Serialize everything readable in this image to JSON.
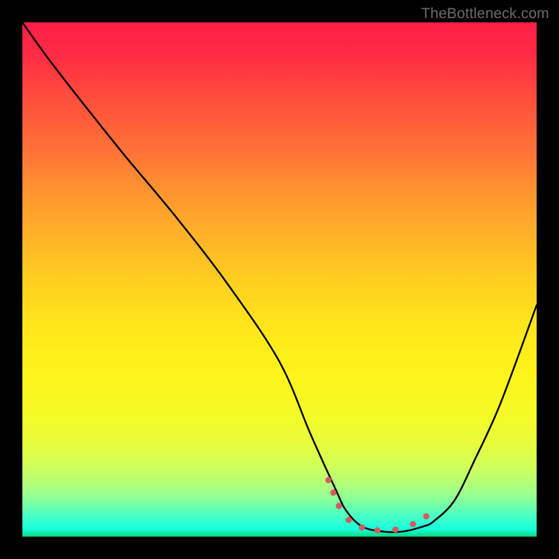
{
  "watermark": "TheBottleneck.com",
  "chart_data": {
    "type": "line",
    "title": "",
    "xlabel": "",
    "ylabel": "",
    "xlim": [
      0,
      100
    ],
    "ylim": [
      0,
      100
    ],
    "series": [
      {
        "name": "bottleneck-curve",
        "x": [
          0,
          5,
          12,
          20,
          30,
          40,
          50,
          56,
          61,
          63,
          66,
          70,
          74,
          78,
          80,
          84,
          88,
          93,
          100
        ],
        "values": [
          100,
          93,
          84,
          74,
          62,
          49,
          34,
          20,
          9,
          5,
          2,
          1,
          1,
          2,
          3,
          7,
          15,
          26,
          45
        ]
      }
    ],
    "markers": {
      "name": "curve-dots",
      "color": "#d45a61",
      "points": [
        {
          "x": 59.5,
          "y": 11
        },
        {
          "x": 60.5,
          "y": 8.5
        },
        {
          "x": 61.5,
          "y": 6
        },
        {
          "x": 63.5,
          "y": 3.2
        },
        {
          "x": 66,
          "y": 1.8
        },
        {
          "x": 69,
          "y": 1.2
        },
        {
          "x": 72.5,
          "y": 1.3
        },
        {
          "x": 76,
          "y": 2.5
        },
        {
          "x": 78.5,
          "y": 4
        }
      ]
    }
  }
}
